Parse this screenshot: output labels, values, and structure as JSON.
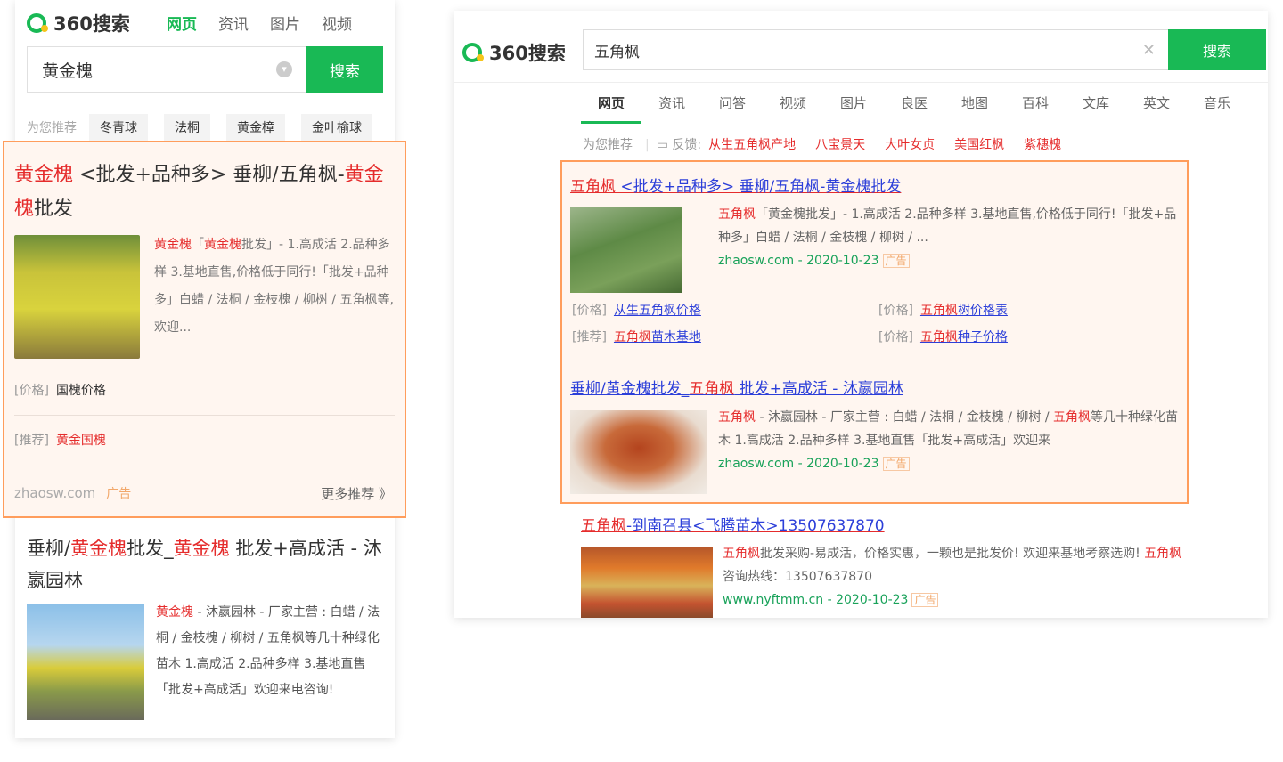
{
  "mobile": {
    "logo_text": "360搜索",
    "nav": [
      "网页",
      "资讯",
      "图片",
      "视频"
    ],
    "search_value": "黄金槐",
    "search_button": "搜索",
    "rec_label": "为您推荐",
    "rec_chips": [
      "冬青球",
      "法桐",
      "黄金樟",
      "金叶榆球"
    ],
    "card": {
      "title_red1": "黄金槐",
      "title_mid": " <批发+品种多> 垂柳/五角枫-",
      "title_red2": "黄金槐",
      "title_end": "批发",
      "snip_red1": "黄金槐",
      "snip_mid": "「",
      "snip_red2": "黄金槐",
      "snip_rest": "批发」- 1.高成活 2.品种多样 3.基地直售,价格低于同行!「批发+品种多」白蜡 / 法桐 / 金枝槐 / 柳树 / 五角枫等,欢迎...",
      "sub1_label": "[价格]",
      "sub1_text": "国槐价格",
      "sub2_label": "[推荐]",
      "sub2_text": "黄金国槐",
      "domain": "zhaosw.com",
      "ad": "广告",
      "more": "更多推荐 》"
    },
    "result2": {
      "title_a": "垂柳/",
      "title_red1": "黄金槐",
      "title_b": "批发_",
      "title_red2": "黄金槐",
      "title_c": " 批发+高成活 - 沐嬴园林",
      "snip_red": "黄金槐",
      "snip_rest": " - 沐嬴园林 - 厂家主营 : 白蜡 / 法桐 / 金枝槐 / 柳树 / 五角枫等几十种绿化苗木 1.高成活 2.品种多样 3.基地直售「批发+高成活」欢迎来电咨询!"
    }
  },
  "desktop": {
    "logo_text": "360搜索",
    "search_value": "五角枫",
    "clear_icon": "✕",
    "search_button": "搜索",
    "tabs": [
      "网页",
      "资讯",
      "问答",
      "视频",
      "图片",
      "良医",
      "地图",
      "百科",
      "文库",
      "英文",
      "音乐"
    ],
    "rec_label": "为您推荐",
    "feedback": "反馈:",
    "rec_links": [
      "从生五角枫产地",
      "八宝景天",
      "大叶女贞",
      "美国红枫",
      "紫穗槐"
    ],
    "card": {
      "t1_red": "五角枫",
      "t1_blue": " <批发+品种多> 垂柳/五角枫-黄金槐批发",
      "snip1_red": "五角枫",
      "snip1_rest": "「黄金槐批发」- 1.高成活 2.品种多样 3.基地直售,价格低于同行!「批发+品种多」白蜡 / 法桐 / 金枝槐 / 柳树 / ...",
      "url1": "zhaosw.com - 2020-10-23",
      "ad": "广告",
      "sub": [
        {
          "label": "[价格]",
          "red": "",
          "blue": "从生五角枫价格"
        },
        {
          "label": "[价格]",
          "red": "五角枫",
          "blue": "树价格表"
        },
        {
          "label": "[推荐]",
          "red": "五角枫",
          "blue": "苗木基地"
        },
        {
          "label": "[价格]",
          "red": "五角枫",
          "blue": "种子价格"
        }
      ],
      "t2_blue": "垂柳/黄金槐批发_",
      "t2_red": "五角枫",
      "t2_blue2": " 批发+高成活 - 沐嬴园林",
      "snip2_red": "五角枫",
      "snip2_mid": " - 沐嬴园林 - 厂家主营 : 白蜡 / 法桐 / 金枝槐 / 柳树 / ",
      "snip2_red2": "五角枫",
      "snip2_rest": "等几十种绿化苗木 1.高成活 2.品种多样 3.基地直售「批发+高成活」欢迎来",
      "url2": "zhaosw.com - 2020-10-23"
    },
    "result3": {
      "t_red": "五角枫",
      "t_blue": "-到南召县<飞腾苗木>13507637870",
      "snip_red": "五角枫",
      "snip_a": "批发采购-易成活，价格实惠，一颗也是批发价! 欢迎来基地考察选购! ",
      "snip_red2": "五角枫",
      "snip_b": "咨询热线：13507637870",
      "url": "www.nyftmm.cn - 2020-10-23",
      "ad": "广告"
    }
  }
}
